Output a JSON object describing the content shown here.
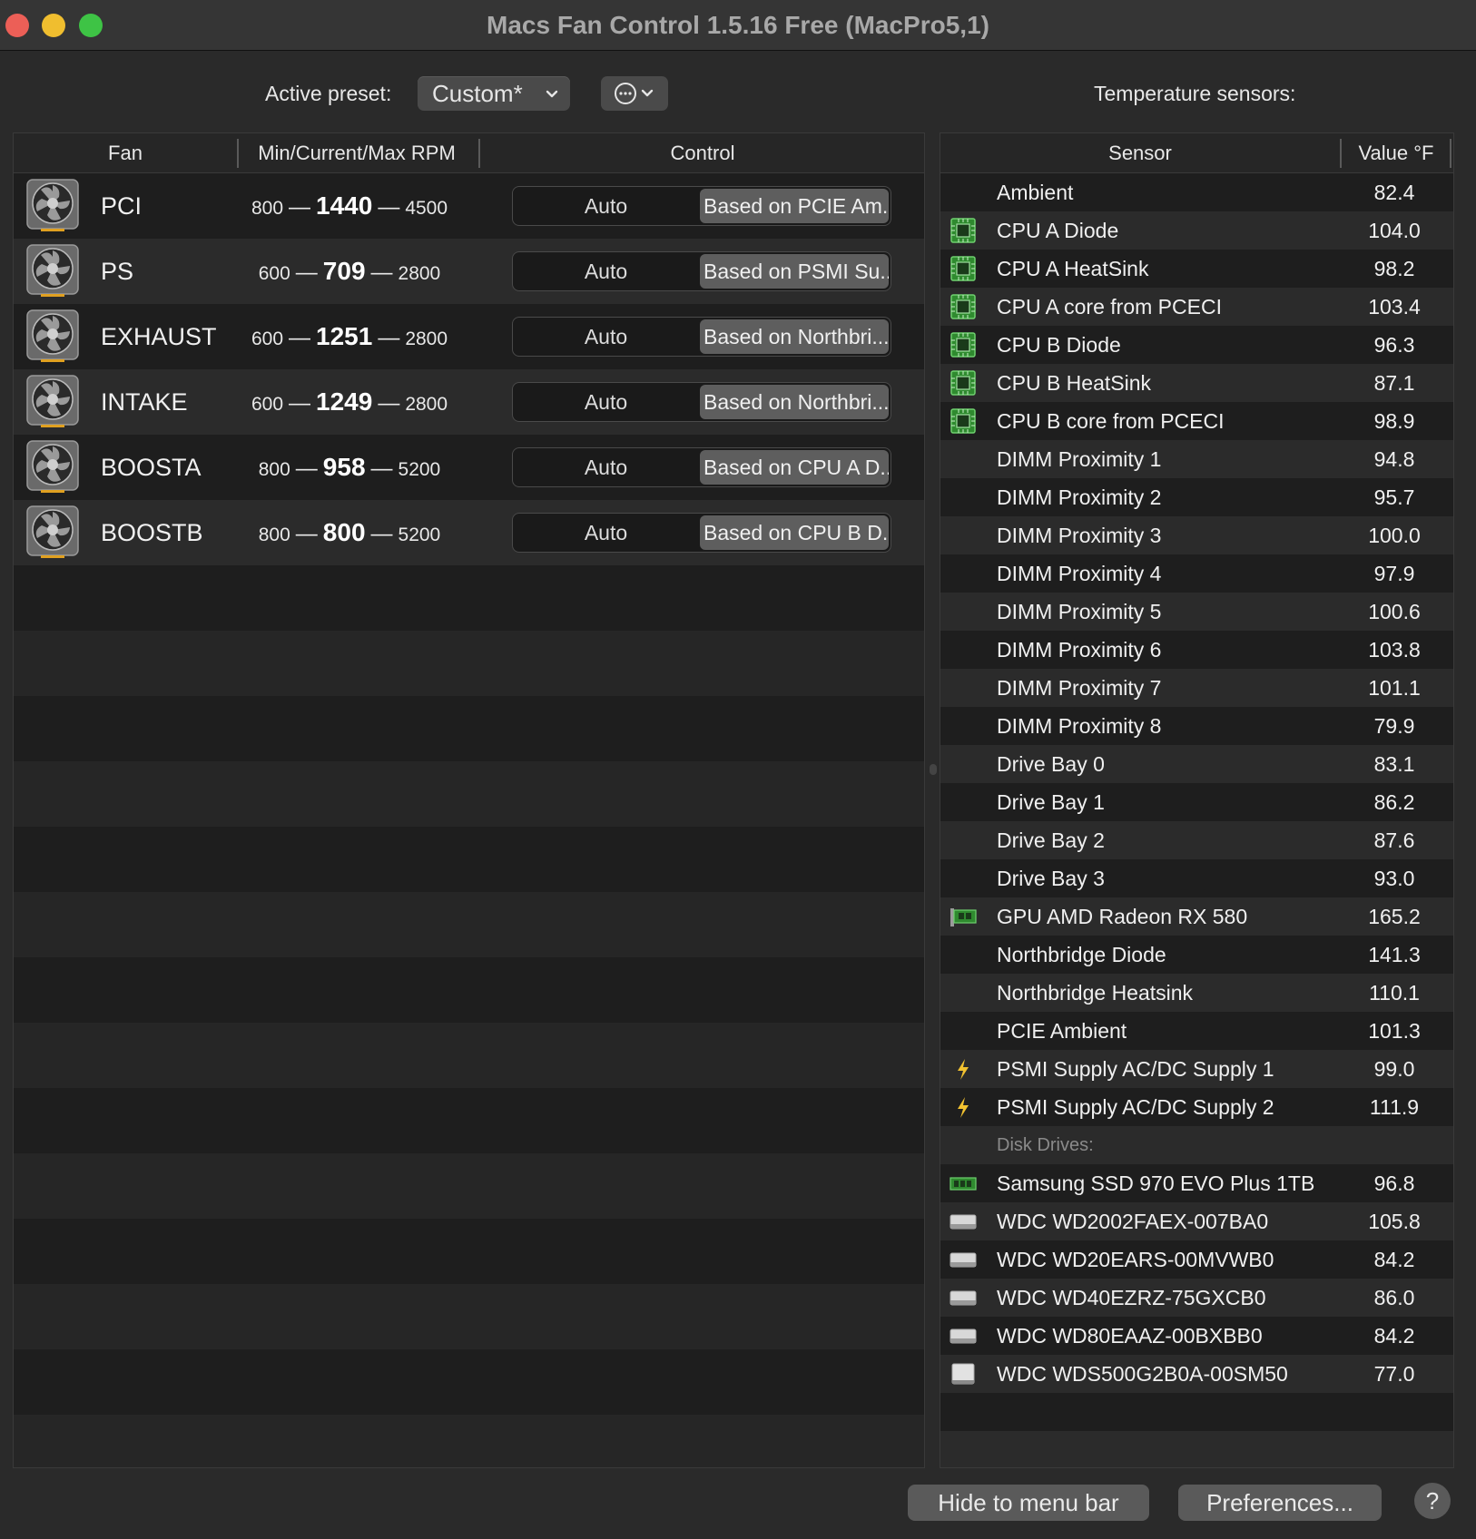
{
  "window": {
    "title": "Macs Fan Control 1.5.16 Free (MacPro5,1)"
  },
  "toolbar": {
    "preset_label": "Active preset:",
    "preset_value": "Custom*",
    "temp_label": "Temperature sensors:"
  },
  "fan_table": {
    "headers": {
      "fan": "Fan",
      "rpm": "Min/Current/Max RPM",
      "control": "Control"
    },
    "fans": [
      {
        "name": "PCI",
        "min": "800",
        "current": "1440",
        "max": "4500",
        "auto": "Auto",
        "mode": "Based on PCIE Am..."
      },
      {
        "name": "PS",
        "min": "600",
        "current": "709",
        "max": "2800",
        "auto": "Auto",
        "mode": "Based on PSMI Su..."
      },
      {
        "name": "EXHAUST",
        "min": "600",
        "current": "1251",
        "max": "2800",
        "auto": "Auto",
        "mode": "Based on Northbri..."
      },
      {
        "name": "INTAKE",
        "min": "600",
        "current": "1249",
        "max": "2800",
        "auto": "Auto",
        "mode": "Based on Northbri..."
      },
      {
        "name": "BOOSTA",
        "min": "800",
        "current": "958",
        "max": "5200",
        "auto": "Auto",
        "mode": "Based on CPU A D..."
      },
      {
        "name": "BOOSTB",
        "min": "800",
        "current": "800",
        "max": "5200",
        "auto": "Auto",
        "mode": "Based on CPU B D..."
      }
    ]
  },
  "sensor_table": {
    "headers": {
      "sensor": "Sensor",
      "value": "Value °F"
    },
    "sensors": [
      {
        "icon": "none",
        "name": "Ambient",
        "value": "82.4"
      },
      {
        "icon": "cpu-icon",
        "name": "CPU A Diode",
        "value": "104.0"
      },
      {
        "icon": "cpu-icon",
        "name": "CPU A HeatSink",
        "value": "98.2"
      },
      {
        "icon": "cpu-icon",
        "name": "CPU A core from PCECI",
        "value": "103.4"
      },
      {
        "icon": "cpu-icon",
        "name": "CPU B Diode",
        "value": "96.3"
      },
      {
        "icon": "cpu-icon",
        "name": "CPU B HeatSink",
        "value": "87.1"
      },
      {
        "icon": "cpu-icon",
        "name": "CPU B core from PCECI",
        "value": "98.9"
      },
      {
        "icon": "none",
        "name": "DIMM Proximity 1",
        "value": "94.8"
      },
      {
        "icon": "none",
        "name": "DIMM Proximity 2",
        "value": "95.7"
      },
      {
        "icon": "none",
        "name": "DIMM Proximity 3",
        "value": "100.0"
      },
      {
        "icon": "none",
        "name": "DIMM Proximity 4",
        "value": "97.9"
      },
      {
        "icon": "none",
        "name": "DIMM Proximity 5",
        "value": "100.6"
      },
      {
        "icon": "none",
        "name": "DIMM Proximity 6",
        "value": "103.8"
      },
      {
        "icon": "none",
        "name": "DIMM Proximity 7",
        "value": "101.1"
      },
      {
        "icon": "none",
        "name": "DIMM Proximity 8",
        "value": "79.9"
      },
      {
        "icon": "none",
        "name": "Drive Bay 0",
        "value": "83.1"
      },
      {
        "icon": "none",
        "name": "Drive Bay 1",
        "value": "86.2"
      },
      {
        "icon": "none",
        "name": "Drive Bay 2",
        "value": "87.6"
      },
      {
        "icon": "none",
        "name": "Drive Bay 3",
        "value": "93.0"
      },
      {
        "icon": "gpu-icon",
        "name": "GPU AMD Radeon RX 580",
        "value": "165.2"
      },
      {
        "icon": "none",
        "name": "Northbridge Diode",
        "value": "141.3"
      },
      {
        "icon": "none",
        "name": "Northbridge Heatsink",
        "value": "110.1"
      },
      {
        "icon": "none",
        "name": "PCIE Ambient",
        "value": "101.3"
      },
      {
        "icon": "bolt-icon",
        "name": "PSMI Supply AC/DC Supply 1",
        "value": "99.0"
      },
      {
        "icon": "bolt-icon",
        "name": "PSMI Supply AC/DC Supply 2",
        "value": "111.9"
      }
    ],
    "disk_group_label": "Disk Drives:",
    "disks": [
      {
        "icon": "ssd-icon",
        "name": "Samsung SSD 970 EVO Plus 1TB",
        "value": "96.8"
      },
      {
        "icon": "hdd-icon",
        "name": "WDC WD2002FAEX-007BA0",
        "value": "105.8"
      },
      {
        "icon": "hdd-icon",
        "name": "WDC WD20EARS-00MVWB0",
        "value": "84.2"
      },
      {
        "icon": "hdd-icon",
        "name": "WDC WD40EZRZ-75GXCB0",
        "value": "86.0"
      },
      {
        "icon": "hdd-icon",
        "name": "WDC WD80EAAZ-00BXBB0",
        "value": "84.2"
      },
      {
        "icon": "sata-ssd-icon",
        "name": "WDC WDS500G2B0A-00SM50",
        "value": "77.0"
      }
    ]
  },
  "footer": {
    "hide_label": "Hide to menu bar",
    "prefs_label": "Preferences...",
    "help_label": "?"
  }
}
